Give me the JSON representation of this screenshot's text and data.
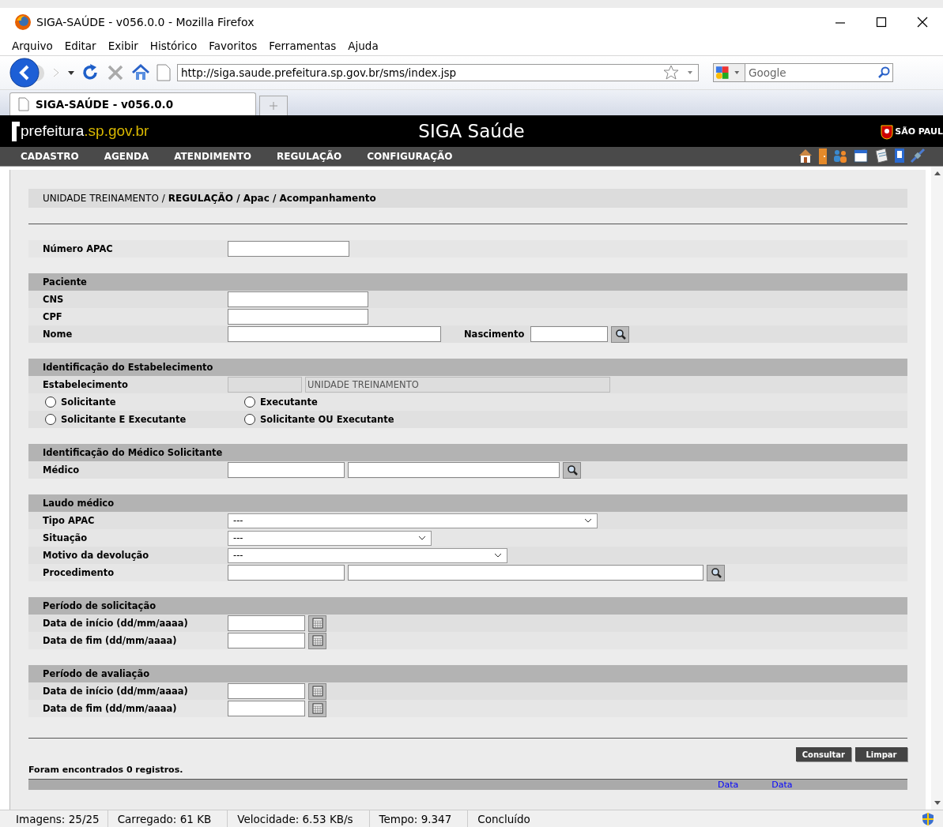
{
  "window": {
    "title": "SIGA-SAÚDE - v056.0.0 - Mozilla Firefox"
  },
  "menu": [
    "Arquivo",
    "Editar",
    "Exibir",
    "Histórico",
    "Favoritos",
    "Ferramentas",
    "Ajuda"
  ],
  "toolbar": {
    "url": "http://siga.saude.prefeitura.sp.gov.br/sms/index.jsp",
    "search_placeholder": "Google"
  },
  "tabs": [
    {
      "label": "SIGA-SAÚDE - v056.0.0",
      "selected": true
    }
  ],
  "site": {
    "logo_main": "prefeitura",
    "logo_domain": ".sp.gov.br",
    "title": "SIGA Saúde",
    "emblem_text": "SÃO PAUL"
  },
  "nav": [
    "CADASTRO",
    "AGENDA",
    "ATENDIMENTO",
    "REGULAÇÃO",
    "CONFIGURAÇÃO"
  ],
  "breadcrumb": {
    "unit": "UNIDADE TREINAMENTO /",
    "path": "REGULAÇÃO / Apac / Acompanhamento"
  },
  "sections": [
    {
      "rows": [
        {
          "kind": "fields",
          "label": "Número APAC",
          "controls": [
            {
              "kind": "text"
            }
          ]
        }
      ]
    },
    {
      "title": "Paciente",
      "rows": [
        {
          "kind": "fields",
          "label": "CNS",
          "controls": [
            {
              "kind": "text"
            }
          ]
        },
        {
          "kind": "fields",
          "label": "CPF",
          "controls": [
            {
              "kind": "text"
            }
          ]
        },
        {
          "kind": "fields",
          "label": "Nome",
          "controls": [
            {
              "kind": "text"
            },
            {
              "kind": "label",
              "text": "Nascimento"
            },
            {
              "kind": "text"
            },
            {
              "kind": "search"
            }
          ]
        }
      ]
    },
    {
      "title": "Identificação do Estabelecimento",
      "rows": [
        {
          "kind": "fields",
          "label": "Estabelecimento",
          "controls": [
            {
              "kind": "text",
              "disabled": true
            },
            {
              "kind": "text",
              "disabled": true,
              "value": "UNIDADE TREINAMENTO"
            }
          ]
        },
        {
          "kind": "radios",
          "options": [
            {
              "label": "Solicitante",
              "selected": false
            },
            {
              "label": "Executante",
              "selected": false
            }
          ]
        },
        {
          "kind": "radios",
          "options": [
            {
              "label": "Solicitante E Executante",
              "selected": false
            },
            {
              "label": "Solicitante OU Executante",
              "selected": false
            }
          ]
        }
      ]
    },
    {
      "title": "Identificação do Médico Solicitante",
      "rows": [
        {
          "kind": "fields",
          "label": "Médico",
          "controls": [
            {
              "kind": "text"
            },
            {
              "kind": "text"
            },
            {
              "kind": "search"
            }
          ]
        }
      ]
    },
    {
      "title": "Laudo médico",
      "rows": [
        {
          "kind": "fields",
          "label": "Tipo APAC",
          "controls": [
            {
              "kind": "select",
              "value": "---"
            }
          ]
        },
        {
          "kind": "fields",
          "label": "Situação",
          "controls": [
            {
              "kind": "select",
              "value": "---"
            }
          ]
        },
        {
          "kind": "fields",
          "label": "Motivo da devolução",
          "controls": [
            {
              "kind": "select",
              "value": "---"
            }
          ]
        },
        {
          "kind": "fields",
          "label": "Procedimento",
          "controls": [
            {
              "kind": "text"
            },
            {
              "kind": "text"
            },
            {
              "kind": "search"
            }
          ]
        }
      ]
    },
    {
      "title": "Período de solicitação",
      "rows": [
        {
          "kind": "fields",
          "label": "Data de início (dd/mm/aaaa)",
          "controls": [
            {
              "kind": "text"
            },
            {
              "kind": "calendar"
            }
          ]
        },
        {
          "kind": "fields",
          "label": "Data de fim (dd/mm/aaaa)",
          "controls": [
            {
              "kind": "text"
            },
            {
              "kind": "calendar"
            }
          ]
        }
      ]
    },
    {
      "title": "Período de avaliação",
      "rows": [
        {
          "kind": "fields",
          "label": "Data de início (dd/mm/aaaa)",
          "controls": [
            {
              "kind": "text"
            },
            {
              "kind": "calendar"
            }
          ]
        },
        {
          "kind": "fields",
          "label": "Data de fim (dd/mm/aaaa)",
          "controls": [
            {
              "kind": "text"
            },
            {
              "kind": "calendar"
            }
          ]
        }
      ]
    }
  ],
  "buttons": [
    "Consultar",
    "Limpar"
  ],
  "result_text": "Foram encontrados 0 registros.",
  "result_columns": [
    "Data",
    "Data"
  ],
  "status_bar": [
    "Imagens: 25/25",
    "Carregado: 61 KB",
    "Velocidade: 6.53 KB/s",
    "Tempo: 9.347",
    "Concluído"
  ]
}
